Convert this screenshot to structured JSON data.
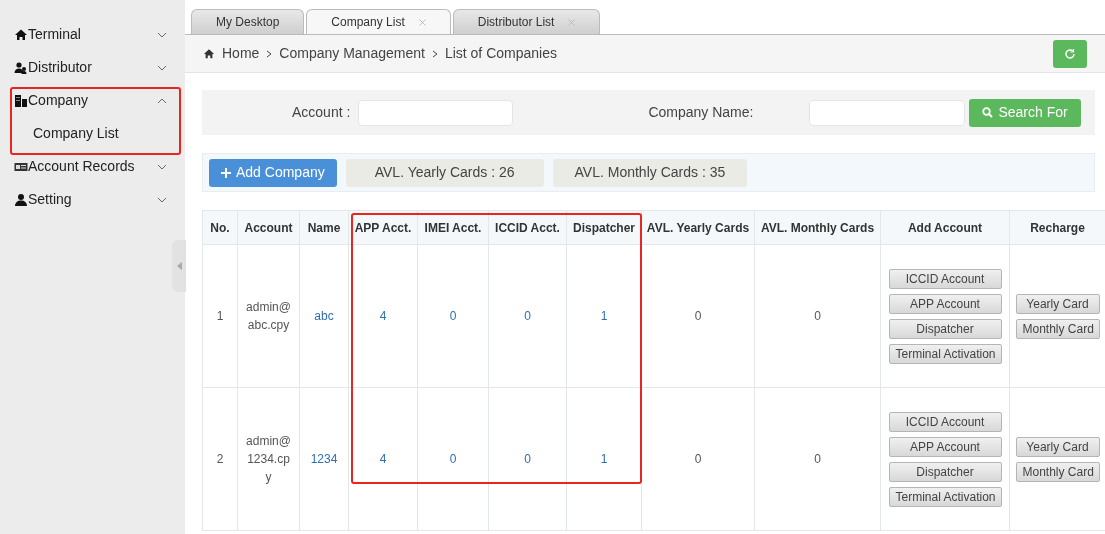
{
  "sidebar": {
    "items": [
      {
        "label": "Terminal",
        "kind": "house",
        "expanded": false,
        "highlighted": false
      },
      {
        "label": "Distributor",
        "kind": "users",
        "expanded": false,
        "highlighted": false
      },
      {
        "label": "Company",
        "kind": "building",
        "expanded": true,
        "highlighted": true,
        "children": [
          {
            "label": "Company List"
          }
        ]
      },
      {
        "label": "Account Records",
        "kind": "card",
        "expanded": false,
        "highlighted": false
      },
      {
        "label": "Setting",
        "kind": "user",
        "expanded": false,
        "highlighted": false
      }
    ]
  },
  "tabs": [
    {
      "label": "My Desktop",
      "selected": false,
      "closable": false
    },
    {
      "label": "Company List",
      "selected": true,
      "closable": true
    },
    {
      "label": "Distributor List",
      "selected": false,
      "closable": true
    }
  ],
  "breadcrumb": [
    "Home",
    "Company Management",
    "List of Companies"
  ],
  "search": {
    "fields": [
      {
        "label": "Account :"
      },
      {
        "label": "Company Name:"
      }
    ],
    "button": "Search For"
  },
  "toolbar": {
    "add_button": "Add Company",
    "stats": [
      "AVL. Yearly Cards : 26",
      "AVL. Monthly Cards : 35"
    ]
  },
  "table": {
    "columns": [
      {
        "label": "No.",
        "kind": "text",
        "highlighted": false
      },
      {
        "label": "Account",
        "kind": "wrap",
        "highlighted": false
      },
      {
        "label": "Name",
        "kind": "link",
        "highlighted": false
      },
      {
        "label": "APP Acct.",
        "kind": "link",
        "highlighted": true
      },
      {
        "label": "IMEI Acct.",
        "kind": "link",
        "highlighted": true
      },
      {
        "label": "ICCID Acct.",
        "kind": "link",
        "highlighted": true
      },
      {
        "label": "Dispatcher",
        "kind": "link",
        "highlighted": true
      },
      {
        "label": "AVL. Yearly Cards",
        "kind": "text",
        "highlighted": false
      },
      {
        "label": "AVL. Monthly Cards",
        "kind": "text",
        "highlighted": false
      },
      {
        "label": "Add Account",
        "kind": "buttons",
        "highlighted": false
      },
      {
        "label": "Recharge",
        "kind": "buttons",
        "highlighted": false
      }
    ],
    "rows": [
      {
        "cells": [
          "1",
          "admin@abc.cpy",
          "abc",
          "4",
          "0",
          "0",
          "1",
          "0",
          "0",
          [
            "ICCID Account",
            "APP Account",
            "Dispatcher",
            "Terminal Activation"
          ],
          [
            "Yearly Card",
            "Monthly Card"
          ]
        ]
      },
      {
        "cells": [
          "2",
          "admin@1234.cpy",
          "1234",
          "4",
          "0",
          "0",
          "1",
          "0",
          "0",
          [
            "ICCID Account",
            "APP Account",
            "Dispatcher",
            "Terminal Activation"
          ],
          [
            "Yearly Card",
            "Monthly Card"
          ]
        ]
      }
    ]
  }
}
